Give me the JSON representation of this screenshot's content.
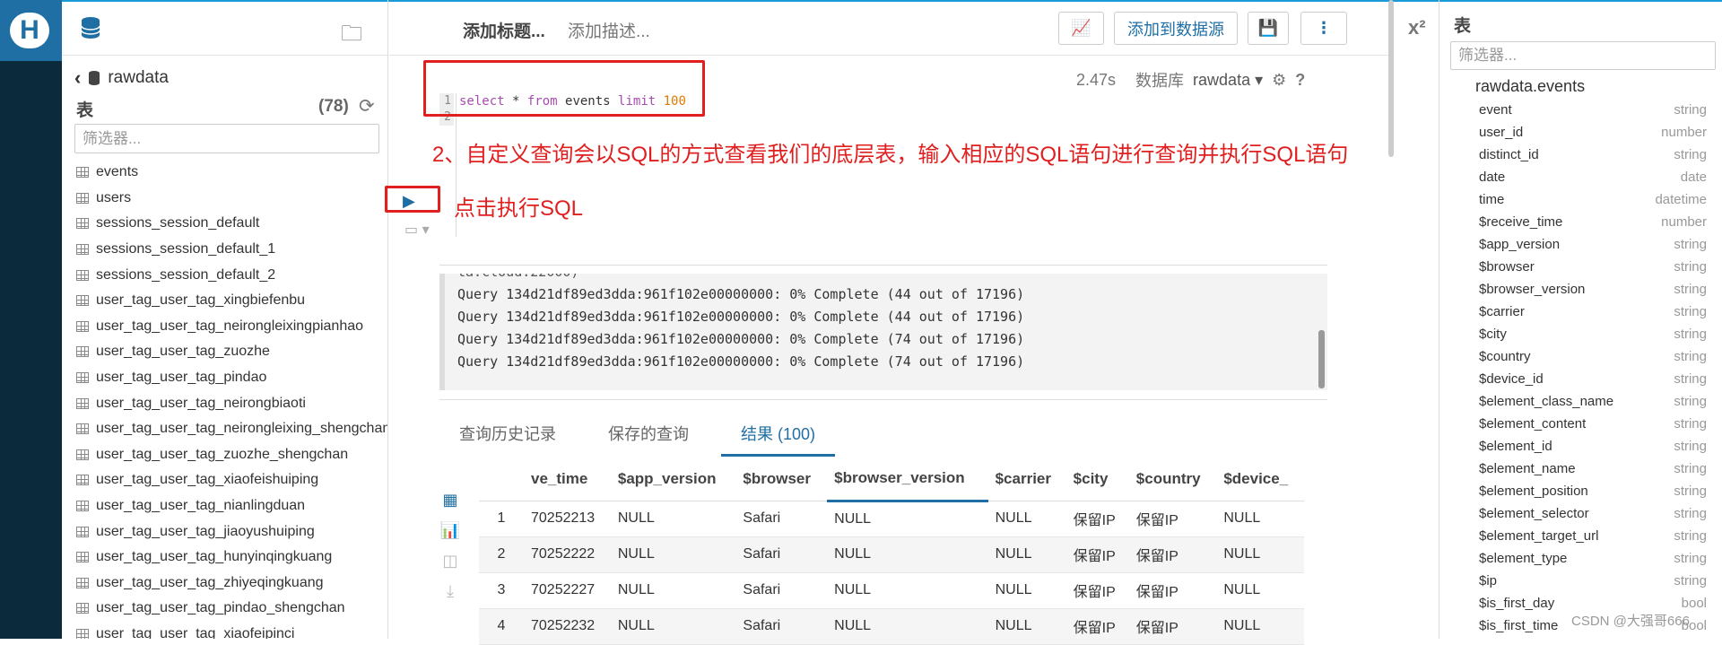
{
  "left_panel": {
    "breadcrumb": "rawdata",
    "section_title": "表",
    "table_count": "(78)",
    "filter_placeholder": "筛选器...",
    "tables": [
      "events",
      "users",
      "sessions_session_default",
      "sessions_session_default_1",
      "sessions_session_default_2",
      "user_tag_user_tag_xingbiefenbu",
      "user_tag_user_tag_neirongleixingpianhao",
      "user_tag_user_tag_zuozhe",
      "user_tag_user_tag_pindao",
      "user_tag_user_tag_neirongbiaoti",
      "user_tag_user_tag_neirongleixing_shengchan",
      "user_tag_user_tag_zuozhe_shengchan",
      "user_tag_user_tag_xiaofeishuiping",
      "user_tag_user_tag_nianlingduan",
      "user_tag_user_tag_jiaoyushuiping",
      "user_tag_user_tag_hunyinqingkuang",
      "user_tag_user_tag_zhiyeqingkuang",
      "user_tag_user_tag_pindao_shengchan",
      "user_tag_user_tag_xiaofeipinci"
    ]
  },
  "editor": {
    "title_placeholder": "添加标题...",
    "desc_placeholder": "添加描述...",
    "add_to_datasource": "添加到数据源",
    "elapsed": "2.47s",
    "db_label": "数据库",
    "db_value": "rawdata",
    "line_numbers": [
      "1",
      "2"
    ],
    "sql_select": "select",
    "sql_star": " * ",
    "sql_from": "from",
    "sql_table": " events ",
    "sql_limit": "limit",
    "sql_num": " 100"
  },
  "annotations": {
    "step2": "2、自定义查询会以SQL的方式查看我们的底层表，输入相应的SQL语句进行查询并执行SQL语句",
    "run_hint": "点击执行SQL"
  },
  "log": {
    "cut_line": "ta.cloud:22000)",
    "lines": [
      "Query 134d21df89ed3dda:961f102e00000000: 0% Complete (44 out of 17196)",
      "Query 134d21df89ed3dda:961f102e00000000: 0% Complete (44 out of 17196)",
      "Query 134d21df89ed3dda:961f102e00000000: 0% Complete (74 out of 17196)",
      "Query 134d21df89ed3dda:961f102e00000000: 0% Complete (74 out of 17196)"
    ]
  },
  "tabs": [
    "查询历史记录",
    "保存的查询",
    "结果 (100)"
  ],
  "result": {
    "headers": [
      "",
      "ve_time",
      "$app_version",
      "$browser",
      "$browser_version",
      "$carrier",
      "$city",
      "$country",
      "$device_"
    ],
    "rows": [
      [
        "1",
        "70252213",
        "NULL",
        "Safari",
        "NULL",
        "NULL",
        "保留IP",
        "保留IP",
        "NULL"
      ],
      [
        "2",
        "70252222",
        "NULL",
        "Safari",
        "NULL",
        "NULL",
        "保留IP",
        "保留IP",
        "NULL"
      ],
      [
        "3",
        "70252227",
        "NULL",
        "Safari",
        "NULL",
        "NULL",
        "保留IP",
        "保留IP",
        "NULL"
      ],
      [
        "4",
        "70252232",
        "NULL",
        "Safari",
        "NULL",
        "NULL",
        "保留IP",
        "保留IP",
        "NULL"
      ]
    ]
  },
  "right_panel": {
    "title": "表",
    "filter_placeholder": "筛选器...",
    "table_name": "rawdata.events",
    "columns": [
      [
        "event",
        "string"
      ],
      [
        "user_id",
        "number"
      ],
      [
        "distinct_id",
        "string"
      ],
      [
        "date",
        "date"
      ],
      [
        "time",
        "datetime"
      ],
      [
        "$receive_time",
        "number"
      ],
      [
        "$app_version",
        "string"
      ],
      [
        "$browser",
        "string"
      ],
      [
        "$browser_version",
        "string"
      ],
      [
        "$carrier",
        "string"
      ],
      [
        "$city",
        "string"
      ],
      [
        "$country",
        "string"
      ],
      [
        "$device_id",
        "string"
      ],
      [
        "$element_class_name",
        "string"
      ],
      [
        "$element_content",
        "string"
      ],
      [
        "$element_id",
        "string"
      ],
      [
        "$element_name",
        "string"
      ],
      [
        "$element_position",
        "string"
      ],
      [
        "$element_selector",
        "string"
      ],
      [
        "$element_target_url",
        "string"
      ],
      [
        "$element_type",
        "string"
      ],
      [
        "$ip",
        "string"
      ],
      [
        "$is_first_day",
        "bool"
      ],
      [
        "$is_first_time",
        "bool"
      ]
    ]
  },
  "watermark": "CSDN @大强哥666",
  "colors": {
    "accent": "#1f6fa5",
    "annotation": "#e02020",
    "sidebar_dark": "#0b2a3c"
  }
}
